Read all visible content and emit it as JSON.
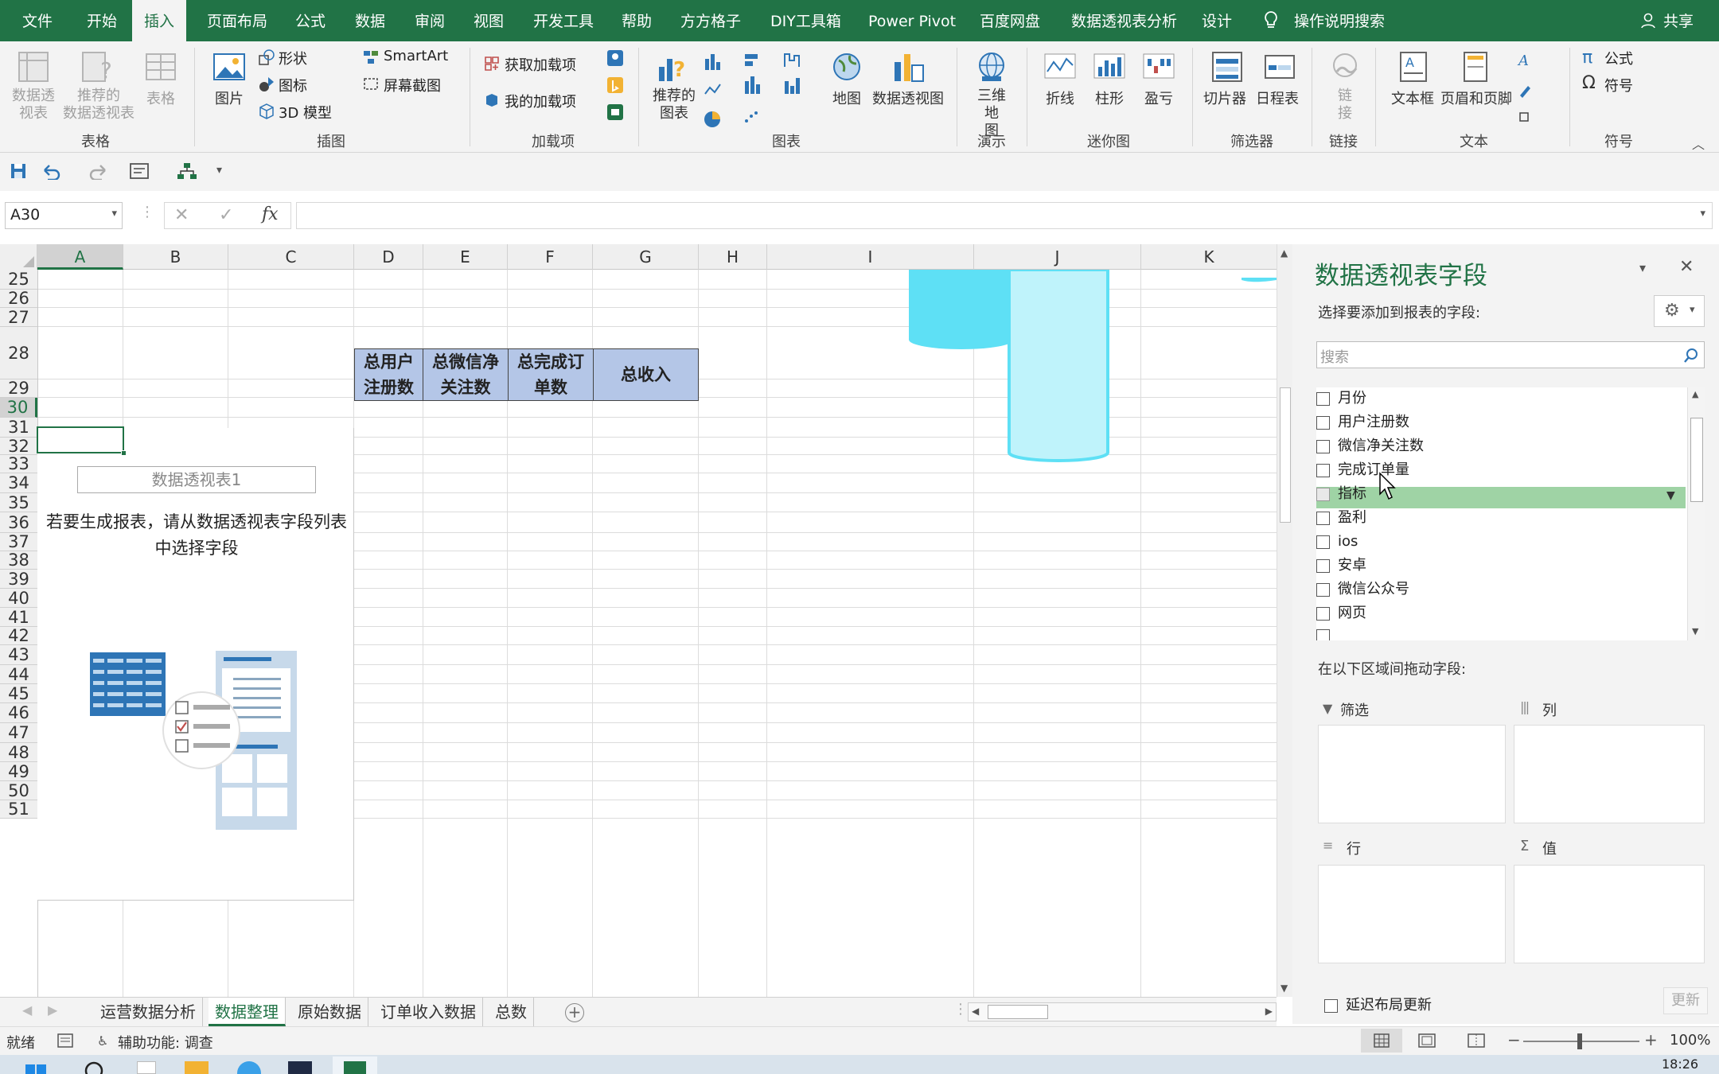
{
  "menu_tabs": [
    "文件",
    "开始",
    "插入",
    "页面布局",
    "公式",
    "数据",
    "审阅",
    "视图",
    "开发工具",
    "帮助",
    "方方格子",
    "DIY工具箱",
    "Power Pivot",
    "百度网盘",
    "数据透视表分析",
    "设计"
  ],
  "active_tab": "插入",
  "tell_me": "操作说明搜索",
  "share": "共享",
  "ribbon": {
    "tables": {
      "pivot": "数据透\n视表",
      "rec_pivot": "推荐的\n数据透视表",
      "table": "表格",
      "group": "表格"
    },
    "illustrations": {
      "picture": "图片",
      "shapes": "形状",
      "icons": "图标",
      "model3d": "3D 模型",
      "smartart": "SmartArt",
      "screenshot": "屏幕截图",
      "group": "插图"
    },
    "addins": {
      "get": "获取加载项",
      "my": "我的加载项",
      "group": "加载项"
    },
    "charts": {
      "recommended": "推荐的\n图表",
      "map": "地图",
      "pivotchart": "数据透视图",
      "group": "图表"
    },
    "tours": {
      "map3d": "三维地\n图",
      "group": "演示"
    },
    "sparklines": {
      "line": "折线",
      "column": "柱形",
      "winloss": "盈亏",
      "group": "迷你图"
    },
    "filters": {
      "slicer": "切片器",
      "timeline": "日程表",
      "group": "筛选器"
    },
    "links": {
      "link": "链\n接",
      "group": "链接"
    },
    "text": {
      "textbox": "文本框",
      "headerfooter": "页眉和页脚",
      "group": "文本"
    },
    "symbols": {
      "equation": "公式",
      "symbol": "符号",
      "group": "符号"
    }
  },
  "name_box": "A30",
  "formula_fx": "fx",
  "columns": [
    "A",
    "B",
    "C",
    "D",
    "E",
    "F",
    "G",
    "H",
    "I",
    "J",
    "K"
  ],
  "rows": [
    "25",
    "26",
    "27",
    "28",
    "29",
    "30",
    "31",
    "32",
    "33",
    "34",
    "35",
    "36",
    "37",
    "38",
    "39",
    "40",
    "41",
    "42",
    "43",
    "44",
    "45",
    "46",
    "47",
    "48",
    "49",
    "50",
    "51"
  ],
  "table_headers": [
    "总用户\n注册数",
    "总微信净\n关注数",
    "总完成订\n单数",
    "总收入"
  ],
  "pivot_placeholder": {
    "name": "数据透视表1",
    "hint": "若要生成报表，请从数据透视表字段列表中选择字段"
  },
  "panel": {
    "title": "数据透视表字段",
    "subtitle": "选择要添加到报表的字段:",
    "search_placeholder": "搜索",
    "fields": [
      "月份",
      "用户注册数",
      "微信净关注数",
      "完成订单量",
      "指标",
      "盈利",
      "ios",
      "安卓",
      "微信公众号",
      "网页"
    ],
    "highlighted_field": "指标",
    "drag_hint": "在以下区域间拖动字段:",
    "zones": {
      "filter": "筛选",
      "columns": "列",
      "rows": "行",
      "values": "值"
    },
    "defer": "延迟布局更新",
    "update": "更新"
  },
  "sheet_tabs": [
    "运营数据分析",
    "数据整理",
    "原始数据",
    "订单收入数据",
    "总数"
  ],
  "active_sheet": "数据整理",
  "status": {
    "ready": "就绪",
    "accessibility": "辅助功能: 调查",
    "zoom": "100%"
  },
  "clock": "18:26",
  "colors": {
    "excel_green": "#217346",
    "header_fill": "#b4c6e7",
    "highlight_green": "#9fd3a5",
    "cylinder_cyan": "#5ee0f5"
  }
}
